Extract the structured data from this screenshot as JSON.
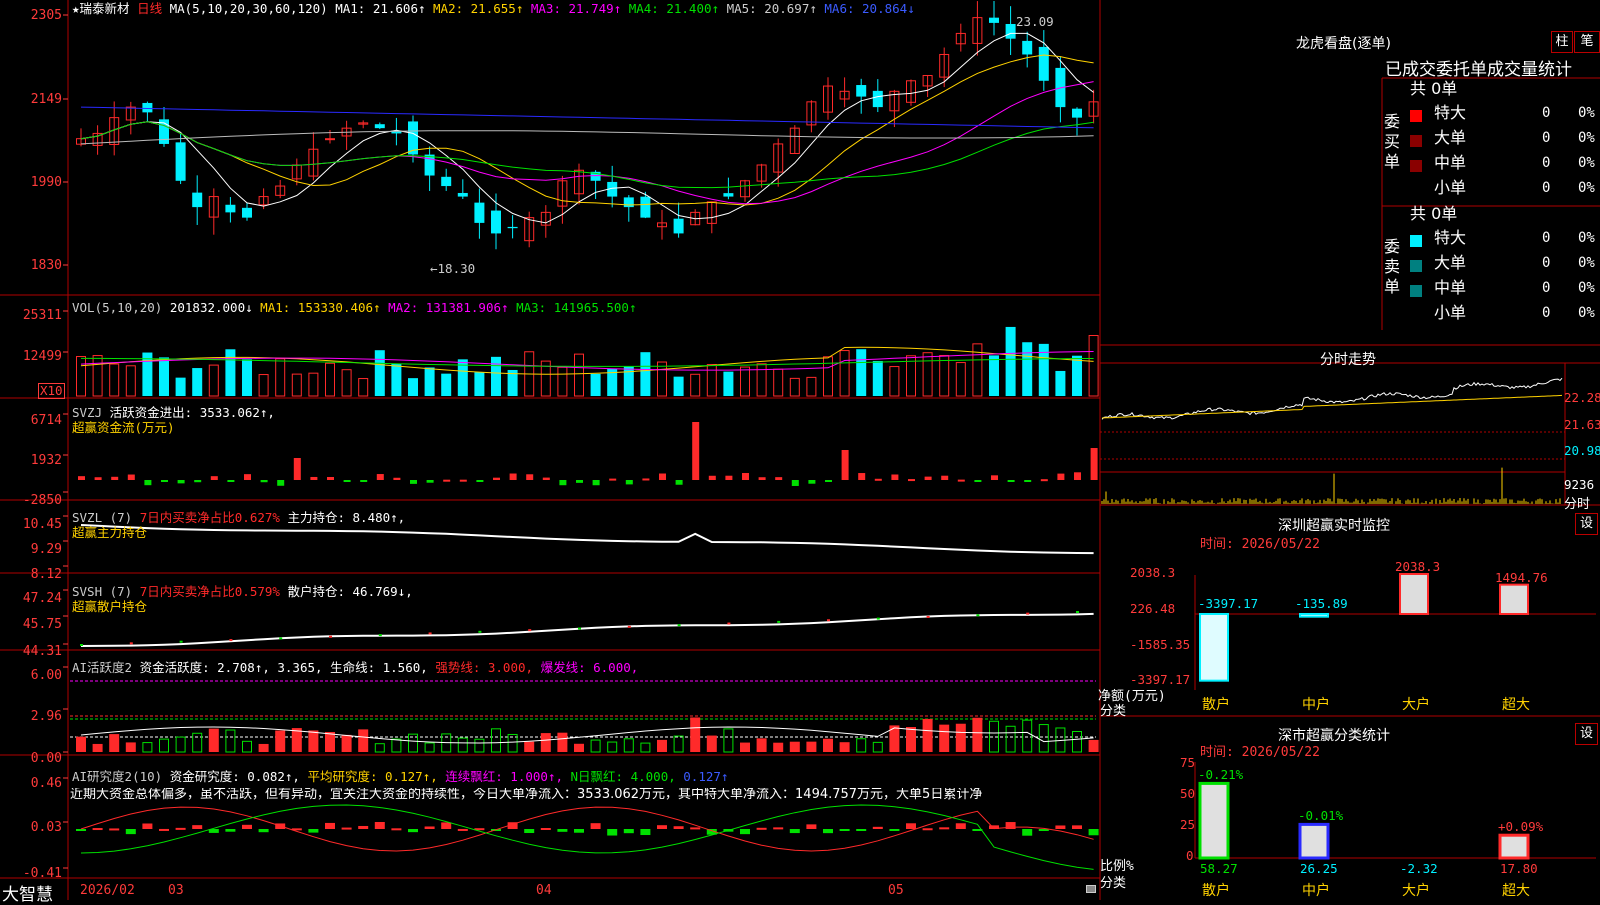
{
  "colors": {
    "up": "#ff2a2a",
    "down": "#00f0ff",
    "grid": "#b00000",
    "white": "#ffffff",
    "yellow": "#ffd200",
    "magenta": "#ff00ff",
    "green": "#00e000",
    "blue": "#2a2aff"
  },
  "stock": {
    "name": "★瑞泰新材",
    "period": "日线"
  },
  "ma_title": {
    "label": "MA(5,10,20,30,60,120)",
    "ma1": "MA1: 21.606↑",
    "ma2": "MA2: 21.655↑",
    "ma3": "MA3: 21.749↑",
    "ma4": "MA4: 21.400↑",
    "ma5": "MA5: 20.697↑",
    "ma6": "MA6: 20.864↓"
  },
  "price_axis": [
    "2305",
    "2149",
    "1990",
    "1830"
  ],
  "price_marks": {
    "high": "23.09",
    "low": "←18.30"
  },
  "vol": {
    "label": "VOL(5,10,20)",
    "value": "201832.000↓",
    "ma1": "MA1: 153330.406↑",
    "ma2": "MA2: 131381.906↑",
    "ma3": "MA3: 141965.500↑",
    "axis": [
      "25311",
      "12499"
    ],
    "unit": "X10"
  },
  "svzj": {
    "label": "SVZJ",
    "text": "活跃资金进出: 3533.062↑,",
    "sub": "超赢资金流(万元)",
    "axis": [
      "6714",
      "1932",
      "-2850"
    ]
  },
  "svzl": {
    "label": "SVZL (7)",
    "t1": "7日内买卖净占比0.627%",
    "t2": "主力持仓: 8.480↑,",
    "sub": "超赢主力持仓",
    "axis": [
      "10.45",
      "9.29",
      "8.12"
    ]
  },
  "svsh": {
    "label": "SVSH (7)",
    "t1": "7日内买卖净占比0.579%",
    "t2": "散户持仓: 46.769↓,",
    "sub": "超赢散户持仓",
    "axis": [
      "47.24",
      "45.75",
      "44.31"
    ]
  },
  "ai2": {
    "label": "AI活跃度2",
    "t1": "资金活跃度: 2.708↑, 3.365,",
    "t2": "生命线: 1.560,",
    "t3": "强势线: 3.000,",
    "t4": "爆发线: 6.000,",
    "axis": [
      "6.00",
      "2.96",
      "0.00"
    ]
  },
  "ai_research": {
    "label": "AI研究度2(10)",
    "t1": "资金研究度: 0.082↑,",
    "t2": "平均研究度: 0.127↑,",
    "t3": "连续飘红: 1.000↑,",
    "t4": "N日飘红: 4.000,",
    "t5": "0.127↑",
    "comment": "近期大资金总体偏多，虽不活跃，但有异动，宜关注大资金的持续性，今日大单净流入：3533.062万元，其中特大单净流入：1494.757万元，大单5日累计净",
    "axis": [
      "0.46",
      "0.03",
      "-0.41"
    ]
  },
  "date_axis": [
    "2026/02",
    "03",
    "04",
    "05"
  ],
  "brand": "大智慧",
  "dragon_tiger": {
    "title": "龙虎看盘(逐单)",
    "btn1": "柱",
    "btn2": "笔",
    "tabs": "已成交委托单成交量统计",
    "buy": {
      "side": "委买单",
      "total": "共 0单",
      "rows": [
        {
          "label": "特大",
          "count": "0",
          "pct": "0%"
        },
        {
          "label": "大单",
          "count": "0",
          "pct": "0%"
        },
        {
          "label": "中单",
          "count": "0",
          "pct": "0%"
        },
        {
          "label": "小单",
          "count": "0",
          "pct": "0%"
        }
      ]
    },
    "sell": {
      "side": "委卖单",
      "total": "共 0单",
      "rows": [
        {
          "label": "特大",
          "count": "0",
          "pct": "0%"
        },
        {
          "label": "大单",
          "count": "0",
          "pct": "0%"
        },
        {
          "label": "中单",
          "count": "0",
          "pct": "0%"
        },
        {
          "label": "小单",
          "count": "0",
          "pct": "0%"
        }
      ]
    }
  },
  "intraday": {
    "title": "分时走势",
    "axis": [
      "22.28",
      "21.63",
      "20.98",
      "9236"
    ],
    "unit": "分时"
  },
  "monitor": {
    "title": "深圳超赢实时监控",
    "btn": "设",
    "date": "时间: 2026/05/22",
    "axis": [
      "2038.3",
      "226.48",
      "-1585.35",
      "-3397.17"
    ],
    "ylabel": "净额(万元)",
    "xlabel": "分类",
    "cats": [
      "散户",
      "中户",
      "大户",
      "超大"
    ],
    "labels": [
      "-3397.17",
      "-135.89",
      "2038.3",
      "1494.76"
    ]
  },
  "classify": {
    "title": "深市超赢分类统计",
    "btn": "设",
    "date": "时间: 2026/05/22",
    "axis": [
      "75",
      "50",
      "25",
      "0"
    ],
    "ylabel": "比例%",
    "xlabel": "分类",
    "cats": [
      "散户",
      "中户",
      "大户",
      "超大"
    ],
    "top": [
      "-0.21%",
      "-0.01%",
      "",
      "+0.09%"
    ],
    "bottom": [
      "58.27",
      "26.25",
      "-2.32",
      "17.80"
    ]
  }
}
